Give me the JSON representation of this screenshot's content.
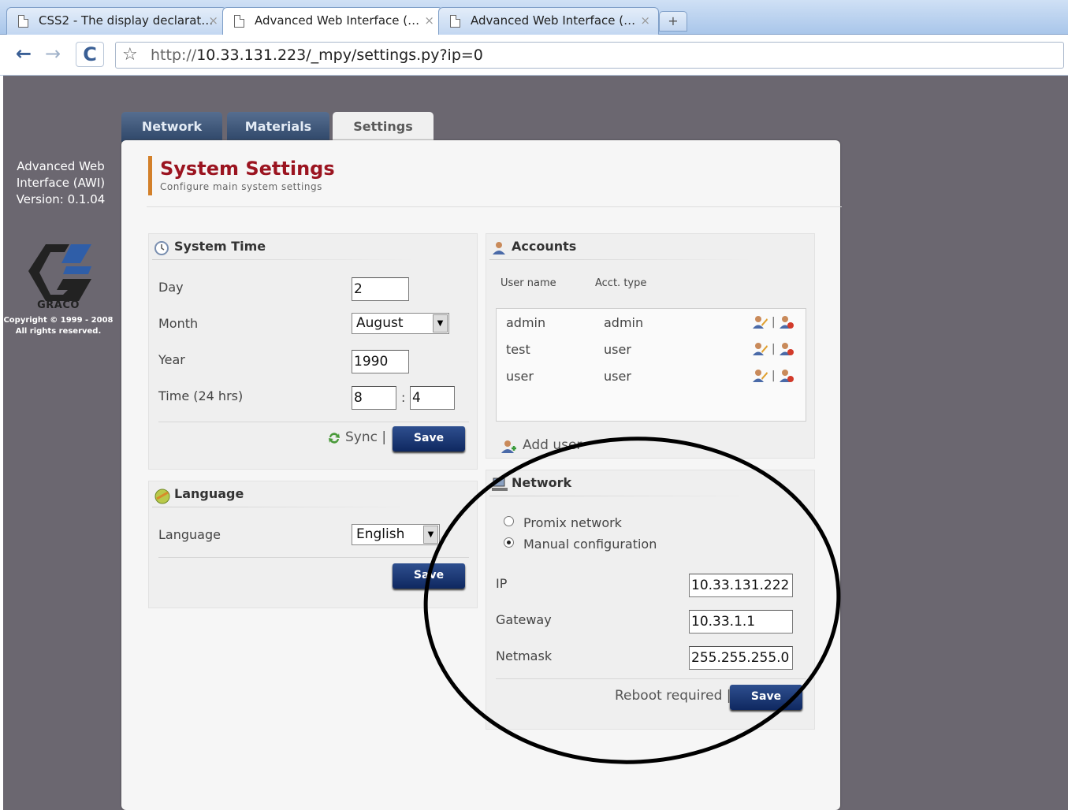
{
  "browser": {
    "tabs": [
      {
        "title": "CSS2 - The display declarat…",
        "active": false
      },
      {
        "title": "Advanced Web Interface (…",
        "active": true
      },
      {
        "title": "Advanced Web Interface (…",
        "active": false
      }
    ],
    "close_glyph": "×",
    "new_tab_glyph": "+",
    "back_glyph": "←",
    "forward_glyph": "→",
    "reload_glyph": "C",
    "star_glyph": "☆",
    "url_prefix": "http://",
    "url_rest": "10.33.131.223/_mpy/settings.py?ip=0"
  },
  "sidebar": {
    "app_name_line1": "Advanced Web",
    "app_name_line2": "Interface (AWI)",
    "version": "Version: 0.1.04",
    "logo_text": "GRACO",
    "copyright_line1": "Copyright © 1999 - 2008",
    "copyright_line2": "All rights reserved."
  },
  "main_tabs": {
    "network": "Network",
    "materials": "Materials",
    "settings": "Settings"
  },
  "header": {
    "title": "System Settings",
    "subtitle": "Configure main system settings"
  },
  "system_time": {
    "title": "System Time",
    "day_label": "Day",
    "day_value": "2",
    "month_label": "Month",
    "month_value": "August",
    "year_label": "Year",
    "year_value": "1990",
    "time_label": "Time (24 hrs)",
    "hour_value": "8",
    "time_separator": ":",
    "minute_value": "4",
    "sync_label": "Sync |",
    "save_label": "Save"
  },
  "language": {
    "title": "Language",
    "language_label": "Language",
    "language_value": "English",
    "save_label": "Save"
  },
  "accounts": {
    "title": "Accounts",
    "col_user": "User name",
    "col_type": "Acct. type",
    "action_separator": "|",
    "rows": [
      {
        "user": "admin",
        "type": "admin"
      },
      {
        "user": "test",
        "type": "user"
      },
      {
        "user": "user",
        "type": "user"
      }
    ],
    "add_user_label": "Add user"
  },
  "network": {
    "title": "Network",
    "option_promix": "Promix network",
    "option_manual": "Manual configuration",
    "selected_option": "Manual configuration",
    "ip_label": "IP",
    "ip_value": "10.33.131.222",
    "gateway_label": "Gateway",
    "gateway_value": "10.33.1.1",
    "netmask_label": "Netmask",
    "netmask_value": "255.255.255.0",
    "reboot_label": "Reboot required |",
    "save_label": "Save"
  },
  "colors": {
    "page_bg": "#6b6770",
    "title_red": "#9b1420",
    "accent_orange": "#d3802a",
    "button_blue": "#0f2860",
    "tab_dark": "#2e4668"
  }
}
